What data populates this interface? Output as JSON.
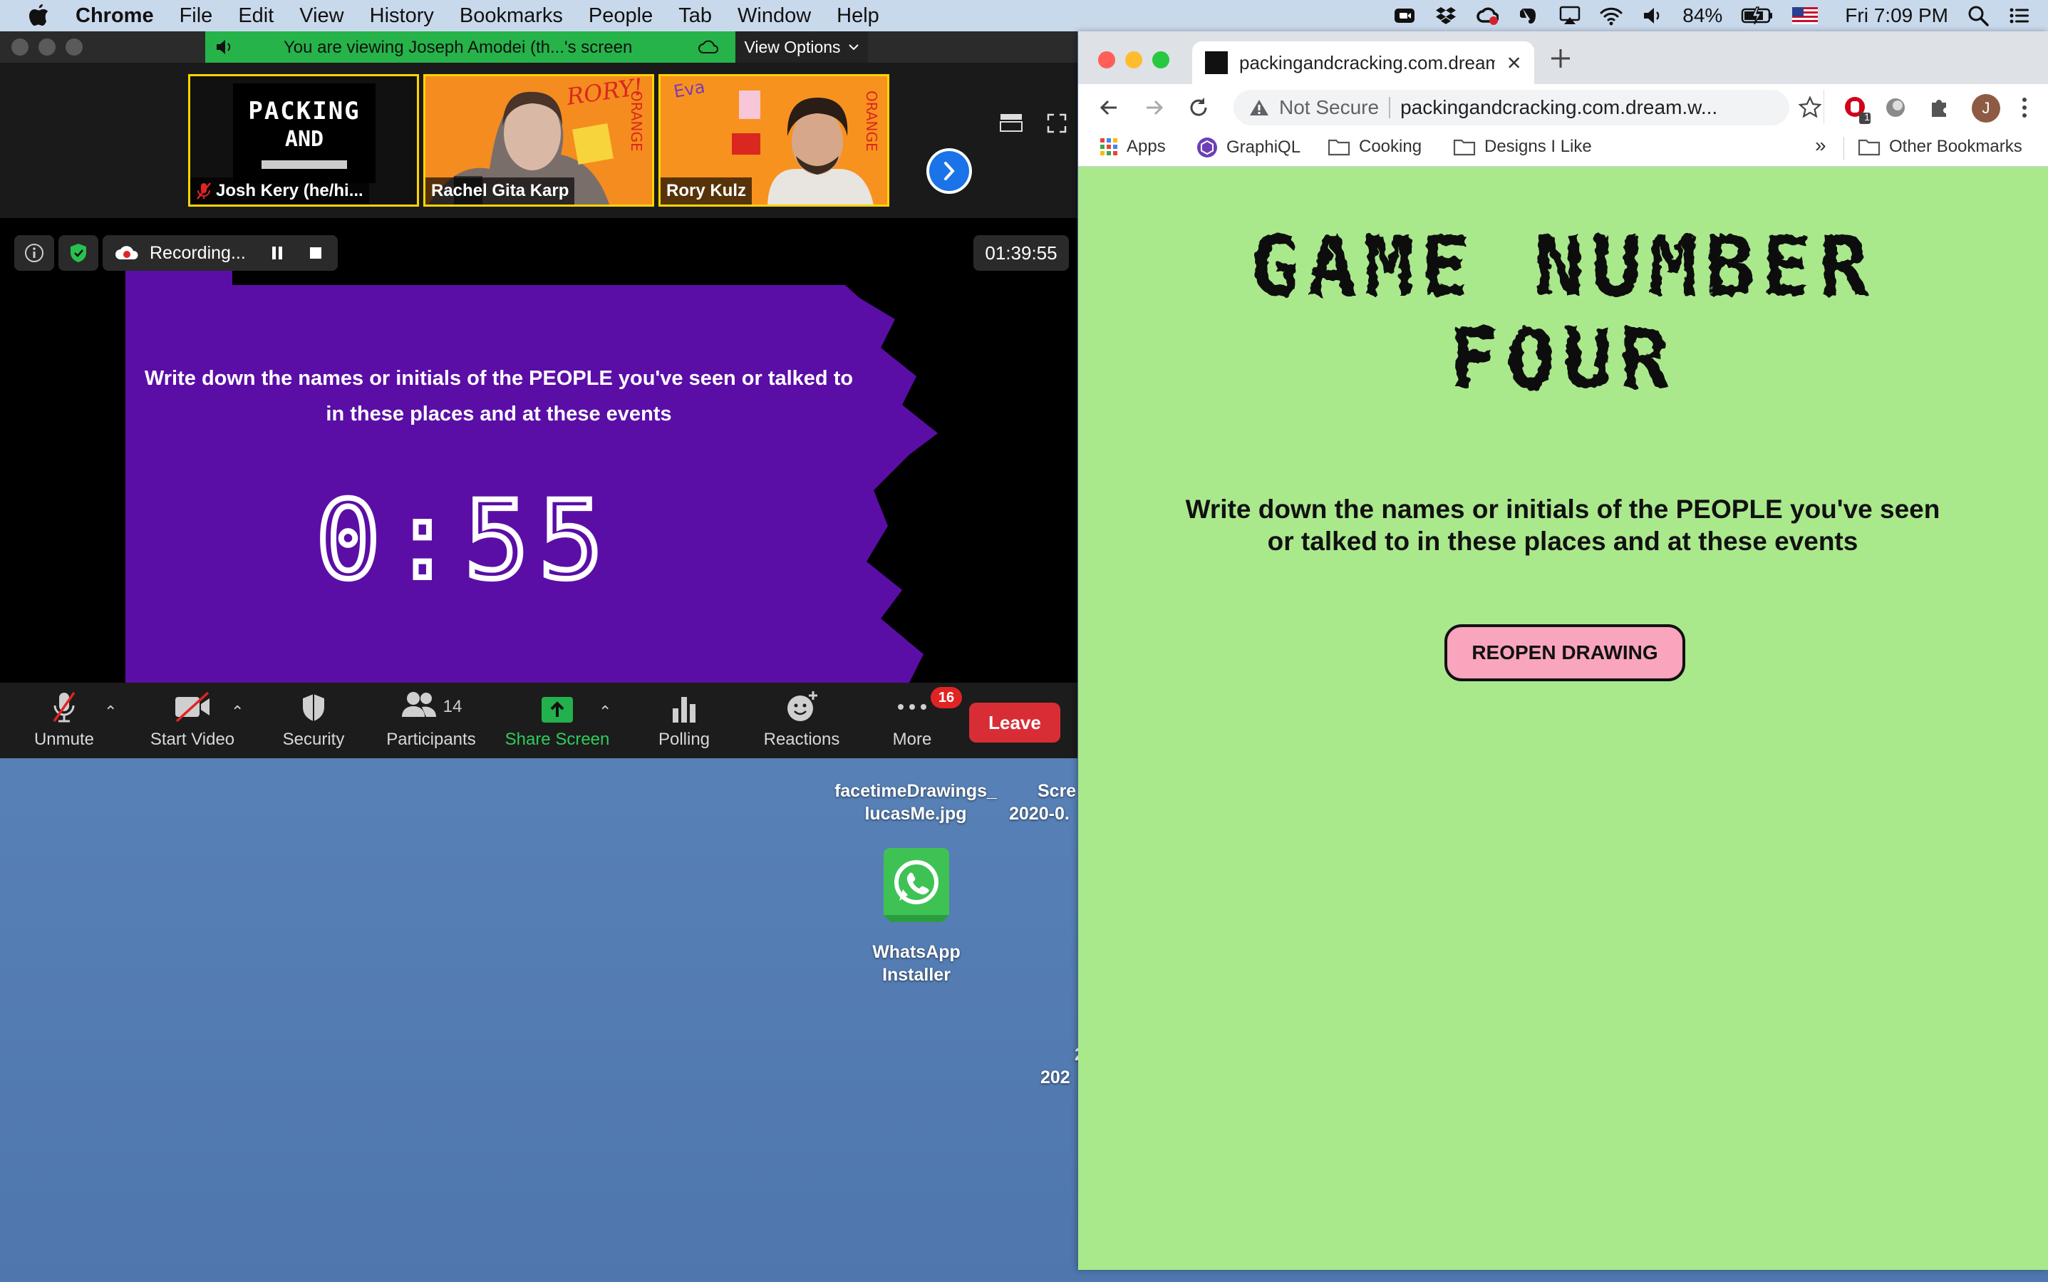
{
  "menubar": {
    "app": "Chrome",
    "items": [
      "File",
      "Edit",
      "View",
      "History",
      "Bookmarks",
      "People",
      "Tab",
      "Window",
      "Help"
    ],
    "battery": "84%",
    "clock": "Fri 7:09 PM"
  },
  "desktop": {
    "items": [
      {
        "label_line1": "facetimeDrawings_",
        "label_line2": "lucasMe.jpg"
      },
      {
        "label_line1": "Scre",
        "label_line2": "2020-0."
      },
      {
        "label_line1": "WhatsApp",
        "label_line2": "Installer"
      },
      {
        "label_line1": "2",
        "label_line2": "202"
      }
    ]
  },
  "zoom": {
    "share_banner": "You are viewing Joseph Amodei (th...'s screen",
    "view_options": "View Options",
    "participants": [
      {
        "name": "Josh Kery (he/hi...",
        "muted": true
      },
      {
        "name": "Rachel Gita Karp",
        "muted": false
      },
      {
        "name": "Rory Kulz",
        "muted": false
      }
    ],
    "thumb_text": {
      "packing_line1": "PACKING",
      "packing_line2": "AND",
      "rory_sign": "RORY!",
      "side_letters": "ORANGE",
      "eva_sign": "Eva"
    },
    "recording_label": "Recording...",
    "elapsed": "01:39:55",
    "shared_instruction": "Write down the names or initials of the PEOPLE you've seen or talked to in these places and at these events",
    "countdown": "0:55",
    "toolbar": {
      "unmute": "Unmute",
      "start_video": "Start Video",
      "security": "Security",
      "participants": "Participants",
      "participant_count": "14",
      "share_screen": "Share Screen",
      "polling": "Polling",
      "reactions": "Reactions",
      "more": "More",
      "more_badge": "16",
      "leave": "Leave"
    }
  },
  "chrome": {
    "tab_title": "packingandcracking.com.dream",
    "not_secure": "Not Secure",
    "url": "packingandcracking.com.dream.w...",
    "profile_initial": "J",
    "extension_badge": "1",
    "bookmarks": [
      "Apps",
      "GraphiQL",
      "Cooking",
      "Designs I Like"
    ],
    "other_bookmarks": "Other Bookmarks",
    "overflow": "»",
    "page": {
      "title_line1": "GAME NUMBER",
      "title_line2": "FOUR",
      "instruction": "Write down the names or initials of the PEOPLE you've seen or talked to in these places and at these events",
      "reopen_button": "REOPEN DRAWING"
    }
  },
  "colors": {
    "zoom_share_green": "#26b34a",
    "shared_purple": "#5b0ea6",
    "page_green": "#aae88c",
    "reopen_pink": "#f8a5bd",
    "leave_red": "#d92d36"
  }
}
